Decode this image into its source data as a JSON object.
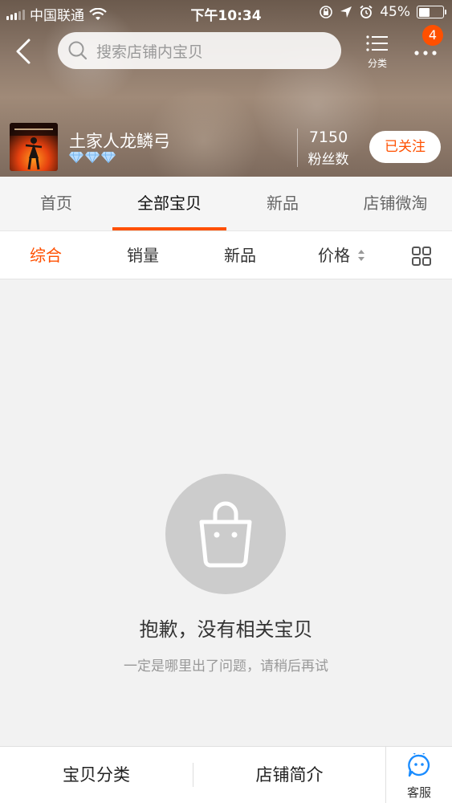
{
  "status_bar": {
    "carrier": "中国联通",
    "time": "下午10:34",
    "battery": "45%",
    "battery_level": 0.45
  },
  "nav": {
    "search_placeholder": "搜索店铺内宝贝",
    "category_label": "分类",
    "badge_count": "4"
  },
  "shop": {
    "name": "土家人龙鳞弓",
    "fans_count": "7150",
    "fans_label": "粉丝数",
    "follow_label": "已关注",
    "diamond_count": 3
  },
  "tabs": [
    {
      "label": "首页"
    },
    {
      "label": "全部宝贝"
    },
    {
      "label": "新品"
    },
    {
      "label": "店铺微淘"
    }
  ],
  "active_tab": "全部宝贝",
  "sort_options": [
    {
      "label": "综合"
    },
    {
      "label": "销量"
    },
    {
      "label": "新品"
    },
    {
      "label": "价格"
    }
  ],
  "active_sort": "综合",
  "empty_state": {
    "title": "抱歉，没有相关宝贝",
    "subtitle": "一定是哪里出了问题，请稍后再试"
  },
  "bottom_bar": {
    "categories_label": "宝贝分类",
    "intro_label": "店铺简介",
    "service_label": "客服"
  },
  "colors": {
    "accent": "#ff5000",
    "empty_icon_bg": "#cccccc"
  }
}
